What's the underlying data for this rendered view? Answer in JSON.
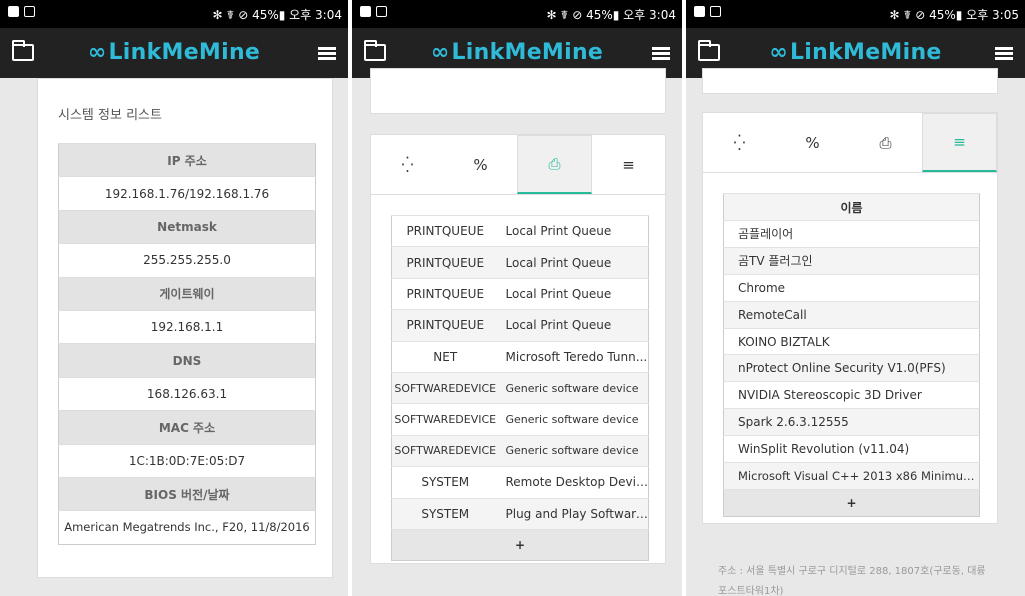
{
  "status": [
    {
      "right": "✻ ☤ ⊘ 45%▮ 오후 3:04"
    },
    {
      "right": "✻ ☤ ⊘ 45%▮ 오후 3:04"
    },
    {
      "right": "✻ ☤ ⊘ 45%▮ 오후 3:05"
    }
  ],
  "app": {
    "logo_symbol": "∞",
    "logo_text": "LinkMeMine"
  },
  "panel1": {
    "title": "시스템 정보 리스트",
    "rows": [
      {
        "label": "IP 주소",
        "value": "192.168.1.76/192.168.1.76"
      },
      {
        "label": "Netmask",
        "value": "255.255.255.0"
      },
      {
        "label": "게이트웨이",
        "value": "192.168.1.1"
      },
      {
        "label": "DNS",
        "value": "168.126.63.1"
      },
      {
        "label": "MAC 주소",
        "value": "1C:1B:0D:7E:05:D7"
      },
      {
        "label": "BIOS 버전/날짜",
        "value": "American Megatrends Inc., F20, 11/8/2016"
      }
    ]
  },
  "panel2": {
    "tabs": [
      "spinner-icon",
      "link-icon",
      "print-icon",
      "list-icon"
    ],
    "active_tab": 2,
    "devices": [
      {
        "type": "PRINTQUEUE",
        "name": "Local Print Queue"
      },
      {
        "type": "PRINTQUEUE",
        "name": "Local Print Queue"
      },
      {
        "type": "PRINTQUEUE",
        "name": "Local Print Queue"
      },
      {
        "type": "PRINTQUEUE",
        "name": "Local Print Queue"
      },
      {
        "type": "NET",
        "name": "Microsoft Teredo Tunn..."
      },
      {
        "type": "SOFTWAREDEVICE",
        "name": "Generic software device"
      },
      {
        "type": "SOFTWAREDEVICE",
        "name": "Generic software device"
      },
      {
        "type": "SOFTWAREDEVICE",
        "name": "Generic software device"
      },
      {
        "type": "SYSTEM",
        "name": "Remote Desktop Devic..."
      },
      {
        "type": "SYSTEM",
        "name": "Plug and Play Software..."
      }
    ],
    "more": "+"
  },
  "panel3": {
    "active_tab": 3,
    "header": "이름",
    "programs": [
      "곰플레이어",
      "곰TV 플러그인",
      "Chrome",
      "RemoteCall",
      "KOINO BIZTALK",
      "nProtect Online Security V1.0(PFS)",
      "NVIDIA Stereoscopic 3D Driver",
      "Spark 2.6.3.12555",
      "WinSplit Revolution (v11.04)",
      "Microsoft Visual C++ 2013 x86 Minimum R..."
    ],
    "more": "+",
    "footer": "주소 : 서울 특별시 구로구 디지털로 288, 1807호(구로동, 대륭포스트타워1차)"
  },
  "colors": {
    "accent": "#2fbad8",
    "tab_active": "#26b99a",
    "appbar": "#222222"
  }
}
